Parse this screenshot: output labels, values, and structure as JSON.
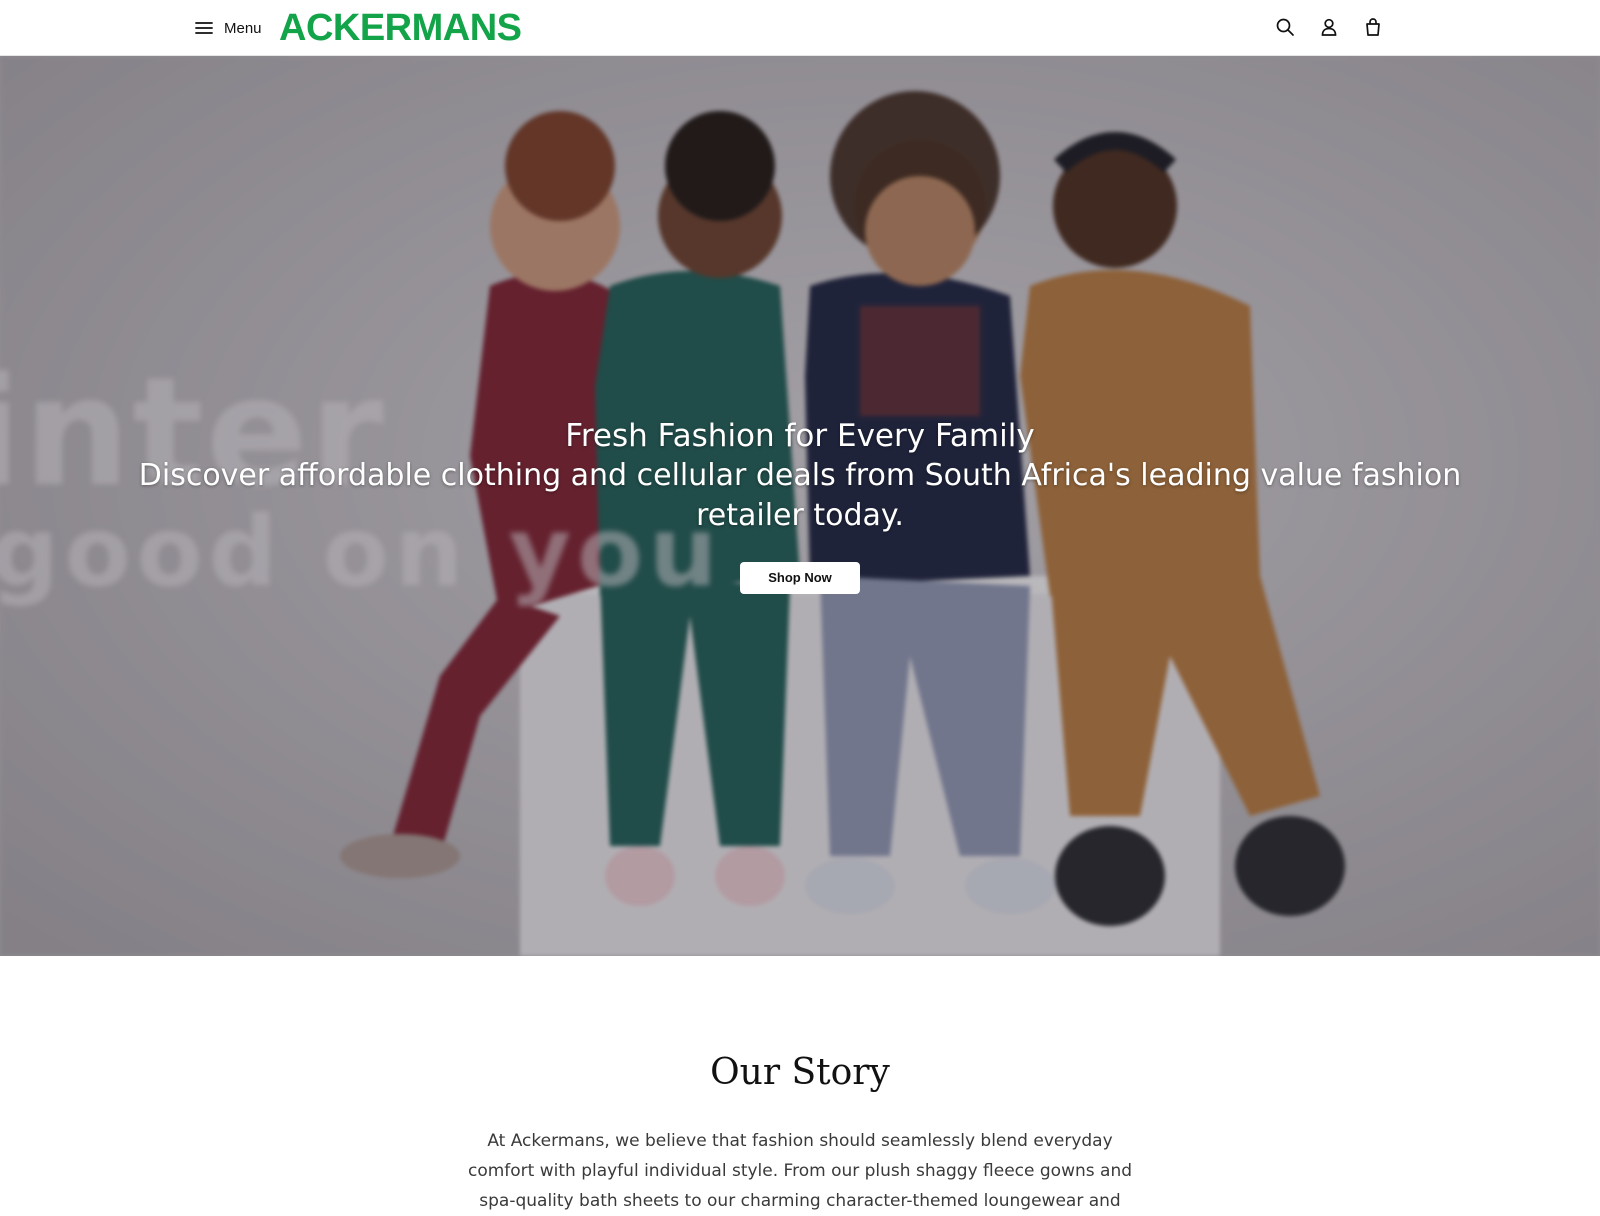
{
  "header": {
    "menu_label": "Menu",
    "logo_text": "ACKERMANS",
    "brand_color": "#13a44a",
    "icons": [
      "menu-icon",
      "search-icon",
      "account-icon",
      "bag-icon"
    ]
  },
  "hero": {
    "title": "Fresh Fashion for Every Family",
    "subtitle": "Discover affordable clothing and cellular deals from South Africa's leading value fashion retailer today.",
    "cta_label": "Shop Now",
    "background_text_line1": "inter",
    "background_text_line2": "good on you"
  },
  "story": {
    "title": "Our Story",
    "body": "At Ackermans, we believe that fashion should seamlessly blend everyday comfort with playful individual style. From our plush shaggy fleece gowns and spa-quality bath sheets to our charming character-themed loungewear and"
  }
}
